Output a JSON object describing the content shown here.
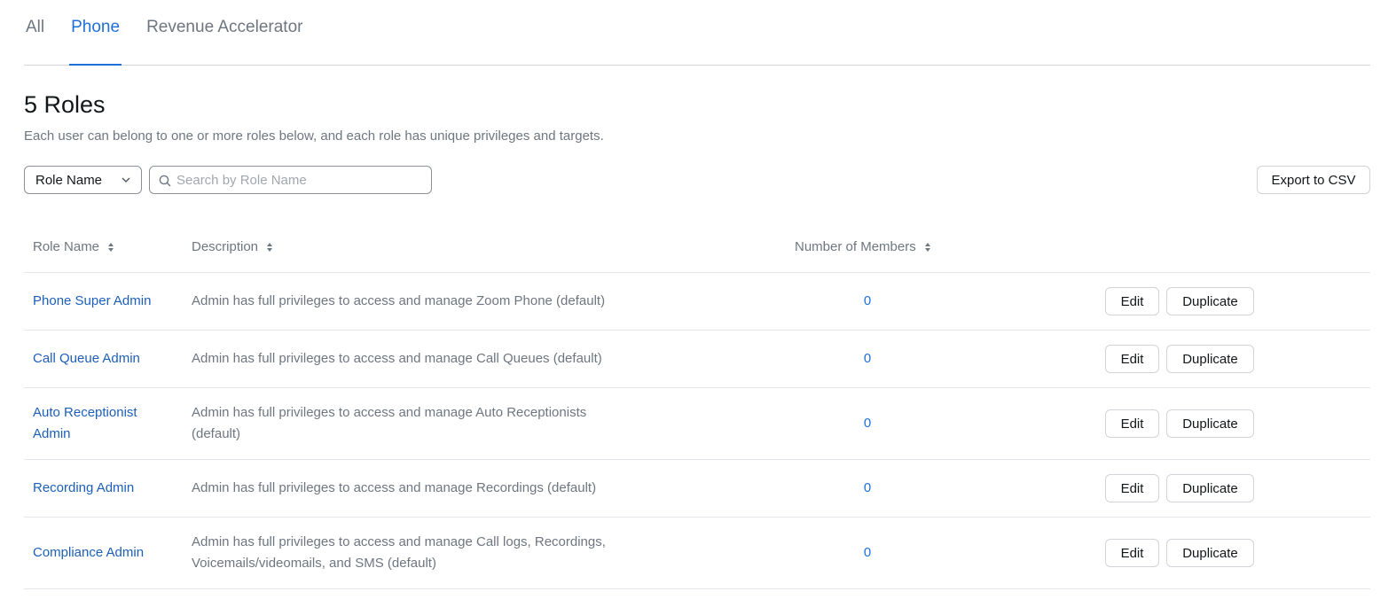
{
  "tabs": [
    {
      "label": "All",
      "active": false
    },
    {
      "label": "Phone",
      "active": true
    },
    {
      "label": "Revenue Accelerator",
      "active": false
    }
  ],
  "header": {
    "title": "5 Roles",
    "subtitle": "Each user can belong to one or more roles below, and each role has unique privileges and targets."
  },
  "filter": {
    "select_value": "Role Name",
    "search_placeholder": "Search by Role Name",
    "export_label": "Export to CSV"
  },
  "table": {
    "columns": {
      "name": "Role Name",
      "description": "Description",
      "members": "Number of Members"
    },
    "rows": [
      {
        "name": "Phone Super Admin",
        "description": "Admin has full privileges to access and manage Zoom Phone (default)",
        "members": "0",
        "edit": "Edit",
        "duplicate": "Duplicate"
      },
      {
        "name": "Call Queue Admin",
        "description": "Admin has full privileges to access and manage Call Queues (default)",
        "members": "0",
        "edit": "Edit",
        "duplicate": "Duplicate"
      },
      {
        "name": "Auto Receptionist Admin",
        "description": "Admin has full privileges to access and manage Auto Receptionists (default)",
        "members": "0",
        "edit": "Edit",
        "duplicate": "Duplicate"
      },
      {
        "name": "Recording Admin",
        "description": "Admin has full privileges to access and manage Recordings (default)",
        "members": "0",
        "edit": "Edit",
        "duplicate": "Duplicate"
      },
      {
        "name": "Compliance Admin",
        "description": "Admin has full privileges to access and manage Call logs, Recordings, Voicemails/videomails, and SMS (default)",
        "members": "0",
        "edit": "Edit",
        "duplicate": "Duplicate"
      }
    ]
  },
  "colors": {
    "accent": "#1f6fd8",
    "link": "#1d5fb8",
    "muted_text": "#6e7680",
    "border": "#e3e5ea"
  }
}
